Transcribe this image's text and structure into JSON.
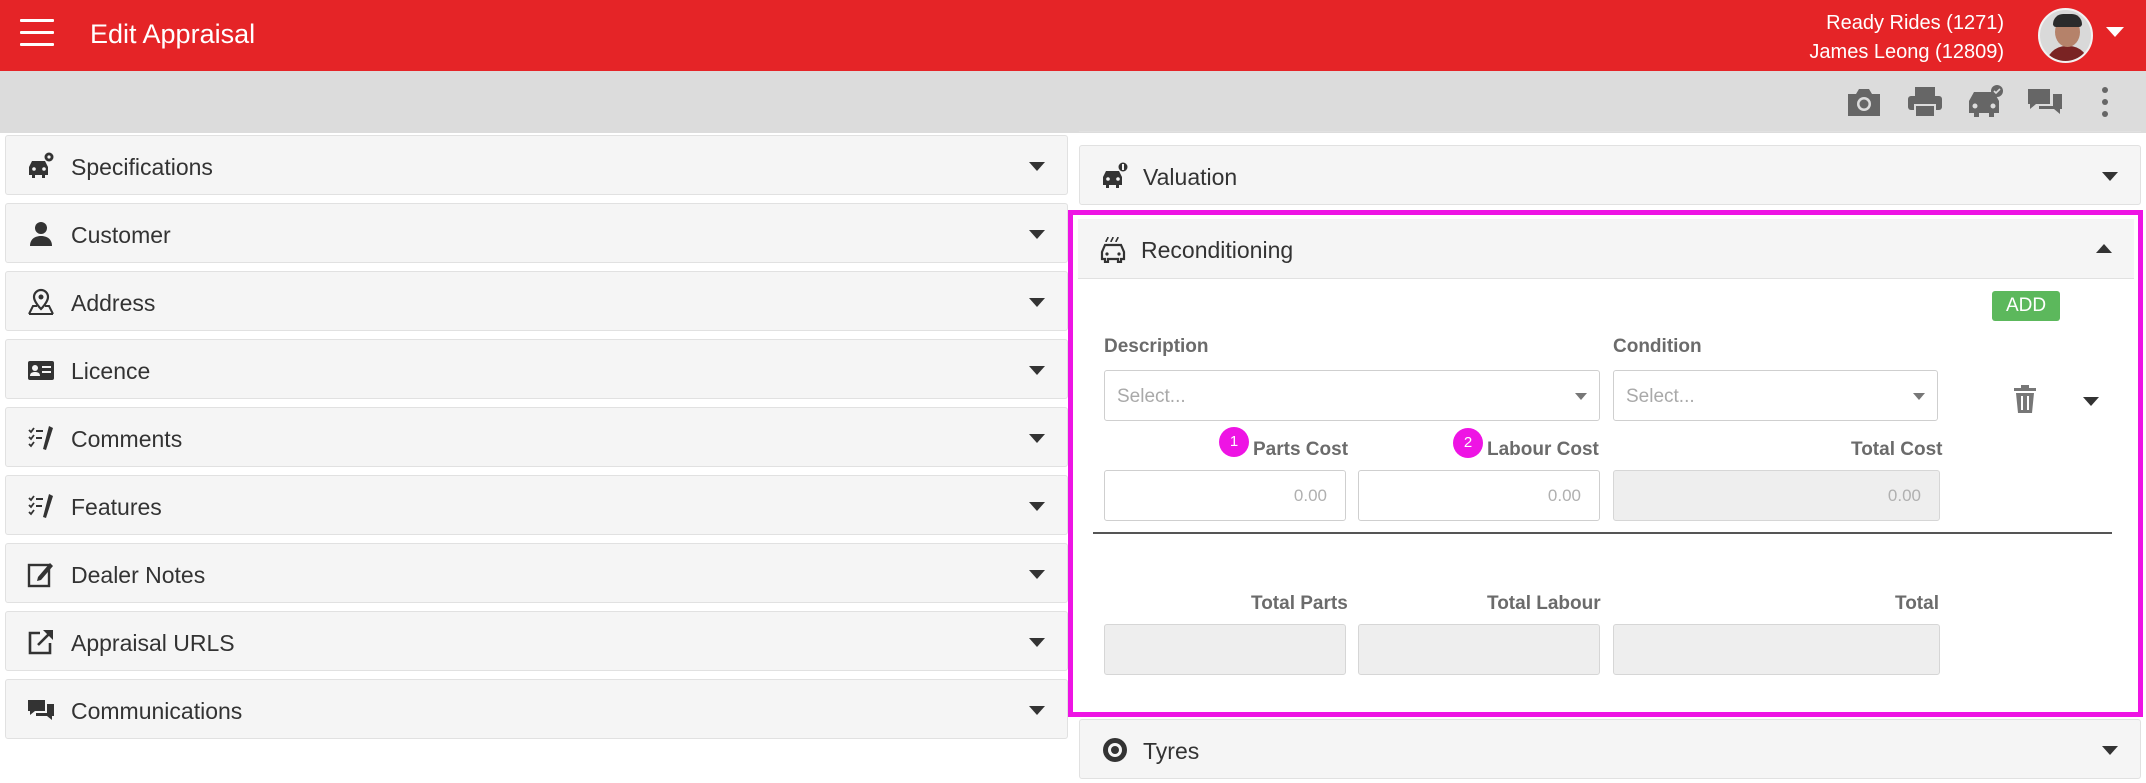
{
  "header": {
    "title": "Edit Appraisal",
    "dealer": "Ready Rides (1271)",
    "user": "James Leong (12809)",
    "bar_color": "#e52427"
  },
  "toolbar": {
    "icons": [
      "camera-icon",
      "print-icon",
      "car-check-icon",
      "chat-icon",
      "more-vert-icon"
    ]
  },
  "left_panels": [
    {
      "label": "Specifications",
      "icon": "car-gear-icon"
    },
    {
      "label": "Customer",
      "icon": "person-icon"
    },
    {
      "label": "Address",
      "icon": "map-pin-icon"
    },
    {
      "label": "Licence",
      "icon": "id-card-icon"
    },
    {
      "label": "Comments",
      "icon": "checklist-pen-icon"
    },
    {
      "label": "Features",
      "icon": "checklist-pen-icon"
    },
    {
      "label": "Dealer Notes",
      "icon": "edit-note-icon"
    },
    {
      "label": "Appraisal URLS",
      "icon": "external-link-icon"
    },
    {
      "label": "Communications",
      "icon": "chat-icon"
    }
  ],
  "valuation": {
    "label": "Valuation",
    "icon": "car-dollar-icon"
  },
  "reconditioning": {
    "label": "Reconditioning",
    "icon": "car-wash-icon",
    "add_label": "ADD",
    "add_color": "#5cb85c",
    "highlight_color": "#ee14e4",
    "description_label": "Description",
    "description_placeholder": "Select...",
    "condition_label": "Condition",
    "condition_placeholder": "Select...",
    "parts_cost_label": "Parts Cost",
    "parts_cost_value": "0.00",
    "parts_badge": "1",
    "labour_cost_label": "Labour Cost",
    "labour_cost_value": "0.00",
    "labour_badge": "2",
    "total_cost_label": "Total Cost",
    "total_cost_value": "0.00",
    "total_parts_label": "Total Parts",
    "total_labour_label": "Total Labour",
    "total_label": "Total"
  },
  "tyres": {
    "label": "Tyres",
    "icon": "tyre-icon"
  }
}
